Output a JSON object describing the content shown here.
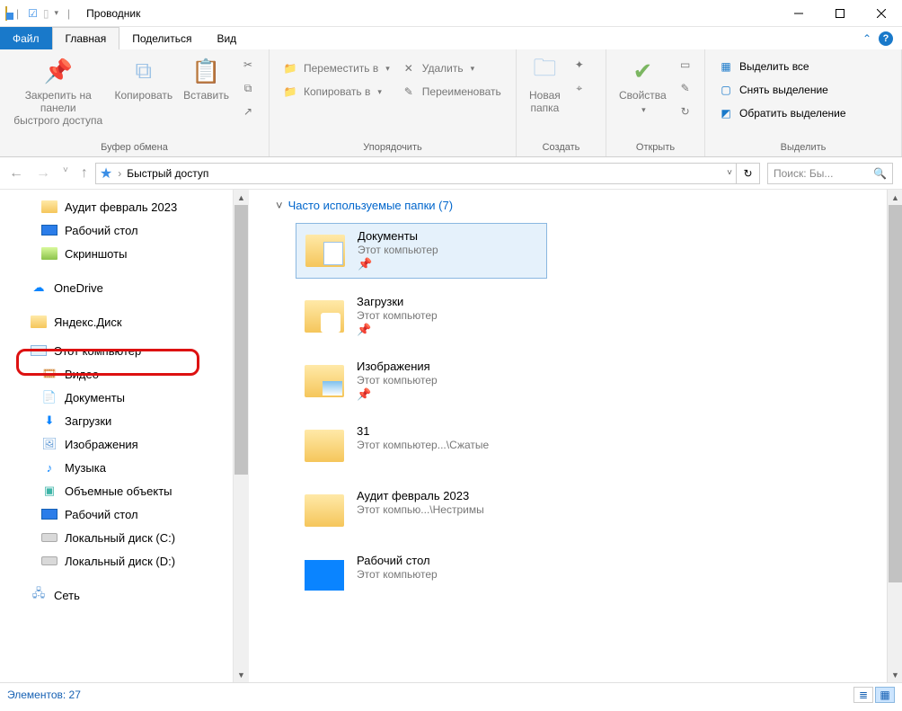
{
  "titlebar": {
    "title": "Проводник"
  },
  "tabs": {
    "file": "Файл",
    "home": "Главная",
    "share": "Поделиться",
    "view": "Вид"
  },
  "ribbon": {
    "clipboard": {
      "pin": "Закрепить на панели\nбыстрого доступа",
      "copy": "Копировать",
      "paste": "Вставить",
      "label": "Буфер обмена"
    },
    "organize": {
      "move": "Переместить в",
      "copyto": "Копировать в",
      "delete": "Удалить",
      "rename": "Переименовать",
      "label": "Упорядочить"
    },
    "new": {
      "newfolder": "Новая\nпапка",
      "label": "Создать"
    },
    "open": {
      "props": "Свойства",
      "label": "Открыть"
    },
    "select": {
      "all": "Выделить все",
      "none": "Снять выделение",
      "invert": "Обратить выделение",
      "label": "Выделить"
    }
  },
  "address": {
    "root": "Быстрый доступ"
  },
  "search": {
    "placeholder": "Поиск: Бы..."
  },
  "tree": {
    "audit": "Аудит февраль 2023",
    "desktop": "Рабочий стол",
    "screens": "Скриншоты",
    "onedrive": "OneDrive",
    "yadisk": "Яндекс.Диск",
    "thispc": "Этот компьютер",
    "video": "Видео",
    "docs": "Документы",
    "dl": "Загрузки",
    "img": "Изображения",
    "music": "Музыка",
    "objects": "Объемные объекты",
    "desk2": "Рабочий стол",
    "cdrive": "Локальный диск (C:)",
    "ddrive": "Локальный диск (D:)",
    "network": "Сеть"
  },
  "section": {
    "title": "Часто используемые папки (7)"
  },
  "cards": [
    {
      "name": "Документы",
      "sub": "Этот компьютер",
      "pinned": true,
      "kind": "doc"
    },
    {
      "name": "Загрузки",
      "sub": "Этот компьютер",
      "pinned": true,
      "kind": "dl"
    },
    {
      "name": "Изображения",
      "sub": "Этот компьютер",
      "pinned": true,
      "kind": "img"
    },
    {
      "name": "31",
      "sub": "Этот компьютер...\\Сжатые",
      "pinned": false,
      "kind": "sheet"
    },
    {
      "name": "Аудит февраль 2023",
      "sub": "Этот компью...\\Нестримы",
      "pinned": false,
      "kind": "sheet"
    },
    {
      "name": "Рабочий стол",
      "sub": "Этот компьютер",
      "pinned": false,
      "kind": "desk"
    }
  ],
  "status": {
    "count": "Элементов: 27"
  }
}
